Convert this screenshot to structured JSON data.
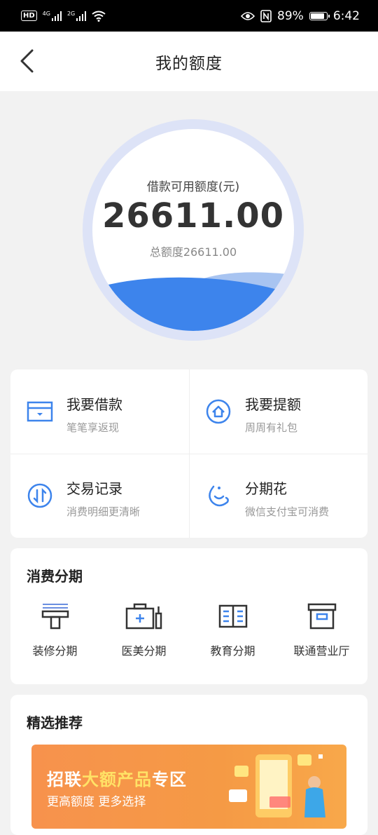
{
  "status_bar": {
    "hd": "HD",
    "net1": "4G",
    "net2": "2G",
    "battery": "89%",
    "time": "6:42"
  },
  "header": {
    "title": "我的额度"
  },
  "quota": {
    "label": "借款可用额度(元)",
    "amount": "26611.00",
    "total": "总额度26611.00"
  },
  "actions": [
    {
      "title": "我要借款",
      "subtitle": "笔笔享返现",
      "icon": "wallet-icon"
    },
    {
      "title": "我要提额",
      "subtitle": "周周有礼包",
      "icon": "home-up-icon"
    },
    {
      "title": "交易记录",
      "subtitle": "消费明细更清晰",
      "icon": "transfer-icon"
    },
    {
      "title": "分期花",
      "subtitle": "微信支付宝可消费",
      "icon": "moon-icon"
    }
  ],
  "installment": {
    "title": "消费分期",
    "items": [
      {
        "label": "装修分期",
        "icon": "paint-roller-icon"
      },
      {
        "label": "医美分期",
        "icon": "medical-kit-icon"
      },
      {
        "label": "教育分期",
        "icon": "book-icon"
      },
      {
        "label": "联通营业厅",
        "icon": "store-box-icon"
      }
    ]
  },
  "recommend": {
    "title": "精选推荐",
    "banner_title_pre": "招联",
    "banner_title_hl": "大额产品",
    "banner_title_post": "专区",
    "banner_sub": "更高额度 更多选择"
  },
  "colors": {
    "primary": "#3d84ec",
    "wave_light": "#a8c4f1",
    "ring": "#dde3f7"
  }
}
